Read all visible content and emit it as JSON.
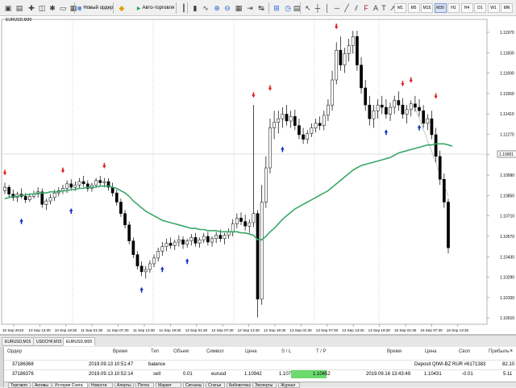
{
  "toolbar": {
    "new_order_label": "Новый ордер",
    "autotrading_label": "Авто-торговля",
    "timeframes": [
      "M1",
      "M5",
      "M15",
      "M30",
      "H1",
      "H4",
      "D1",
      "W1",
      "MN"
    ],
    "icons": [
      "new-chart-icon",
      "profiles-icon",
      "market-watch-icon",
      "data-window-icon",
      "navigator-icon",
      "terminal-icon",
      "tester-icon",
      "new-order-icon",
      "metaeditor-icon",
      "autotrading-icon",
      "bar-chart-icon",
      "candlestick-icon",
      "line-chart-icon",
      "zoom-in-icon",
      "zoom-out-icon",
      "tile-windows-icon",
      "chart-shift-icon",
      "autoscroll-icon",
      "indicators-icon",
      "periods-icon",
      "templates-icon",
      "cursor-icon",
      "crosshair-icon",
      "vertical-line-icon",
      "horizontal-line-icon",
      "trendline-icon",
      "equidistant-channel-icon",
      "fibonacci-icon",
      "text-icon",
      "text-label-icon",
      "arrows-icon"
    ]
  },
  "chart": {
    "title": "EURUSD,M30",
    "current_price_label": "1.10001",
    "price_labels": [
      "1.11970",
      "1.11830",
      "1.11690",
      "1.11550",
      "1.11410",
      "1.11270",
      "1.11130",
      "1.10990",
      "1.10850",
      "1.10710",
      "1.10570",
      "1.10430",
      "1.10290",
      "1.10150",
      "1.10010",
      "1.09870",
      "1.09730",
      "1.09590",
      "1.09450"
    ],
    "time_labels": [
      "10 Sep 2019",
      "10 Sep 13:30",
      "10 Sep 19:30",
      "11 Sep 01:30",
      "11 Sep 07:30",
      "11 Sep 13:30",
      "11 Sep 19:30",
      "12 Sep 01:30",
      "12 Sep 07:30",
      "12 Sep 13:30",
      "12 Sep 19:30",
      "13 Sep 01:30",
      "13 Sep 07:30",
      "13 Sep 13:30",
      "13 Sep 19:30",
      "16 Sep 01:30",
      "16 Sep 07:30",
      "16 Sep 13:30"
    ],
    "colors": {
      "background": "#ffffff",
      "bull_body": "#ffffff",
      "bear_body": "#000000",
      "moving_average": "#3aa86a",
      "sell_arrow": "#e02020",
      "buy_arrow": "#1030c0",
      "grid": "#c0c0c0"
    }
  },
  "chart_tabs": [
    "EURUSD,M15",
    "USDCHF,M15",
    "EURUSD,M30"
  ],
  "chart_tabs_active": 2,
  "terminal": {
    "headers": {
      "order": "Ордер",
      "time": "Время",
      "type": "Тип",
      "volume": "Объем",
      "symbol": "Символ",
      "price": "Цена",
      "sl": "S / L",
      "tp": "T / P",
      "time2": "Время",
      "price2": "Цена",
      "swap": "Своп",
      "profit": "Прибыль"
    },
    "rows": [
      {
        "order": "37186368",
        "time": "2019.09.13 10:51:47",
        "type": "balance",
        "comment": "Deposit QIWI-BZ RUR #6171383",
        "profit": "82.10"
      },
      {
        "order": "37186376",
        "time": "2019.09.13 10:52:14",
        "type": "sell",
        "volume": "0.01",
        "symbol": "eurusd",
        "price": "1.10942",
        "sl": "1.10710",
        "tp": "1.10452",
        "time2": "2019.09.16 13:43:49",
        "price2": "1.10431",
        "swap": "-0.01",
        "profit": "5.11"
      }
    ],
    "bottom_tabs": [
      "Торговля",
      "Активы",
      "История Счета",
      "Новости",
      "Алерты",
      "Почта",
      "Маркет",
      "Сигналы",
      "Статьи",
      "Библиотека",
      "Эксперты",
      "Журнал"
    ],
    "bottom_tabs_active": 2,
    "side_label": "Терминал"
  },
  "chart_data": {
    "type": "candlestick",
    "symbol": "EURUSD",
    "timeframe": "M30",
    "price_range": [
      1.0938,
      1.1205
    ],
    "x_range": [
      "10 Sep 2019",
      "16 Sep 13:30"
    ],
    "grid": true,
    "series": [
      {
        "values": [
          [
            1.1055,
            1.1062,
            1.1052,
            1.1058
          ],
          [
            1.1058,
            1.106,
            1.1049,
            1.1052
          ],
          [
            1.1052,
            1.1056,
            1.1046,
            1.1049
          ],
          [
            1.1049,
            1.1054,
            1.1045,
            1.1052
          ],
          [
            1.1052,
            1.1057,
            1.1048,
            1.105
          ],
          [
            1.105,
            1.1053,
            1.1044,
            1.1047
          ],
          [
            1.1047,
            1.1052,
            1.1045,
            1.105
          ],
          [
            1.105,
            1.1055,
            1.1048,
            1.1052
          ],
          [
            1.1052,
            1.1058,
            1.1049,
            1.1054
          ],
          [
            1.1054,
            1.1057,
            1.104,
            1.1043
          ],
          [
            1.1043,
            1.1048,
            1.1038,
            1.1046
          ],
          [
            1.1046,
            1.1052,
            1.1043,
            1.1049
          ],
          [
            1.1049,
            1.1056,
            1.1046,
            1.1053
          ],
          [
            1.1053,
            1.1058,
            1.105,
            1.1055
          ],
          [
            1.1055,
            1.106,
            1.1052,
            1.1057
          ],
          [
            1.1057,
            1.1064,
            1.1053,
            1.1061
          ],
          [
            1.1061,
            1.1065,
            1.1055,
            1.1058
          ],
          [
            1.1058,
            1.1063,
            1.1055,
            1.106
          ],
          [
            1.106,
            1.1066,
            1.1057,
            1.1063
          ],
          [
            1.1063,
            1.1068,
            1.1058,
            1.1061
          ],
          [
            1.1061,
            1.1064,
            1.1054,
            1.1057
          ],
          [
            1.1057,
            1.1062,
            1.1054,
            1.106
          ],
          [
            1.106,
            1.1066,
            1.1058,
            1.1064
          ],
          [
            1.1064,
            1.1068,
            1.1059,
            1.1062
          ],
          [
            1.1062,
            1.1066,
            1.1058,
            1.1063
          ],
          [
            1.1063,
            1.1066,
            1.1055,
            1.1058
          ],
          [
            1.1058,
            1.1062,
            1.105,
            1.1053
          ],
          [
            1.1053,
            1.1056,
            1.1042,
            1.1045
          ],
          [
            1.1045,
            1.1048,
            1.1032,
            1.1035
          ],
          [
            1.1035,
            1.1038,
            1.1022,
            1.1025
          ],
          [
            1.1025,
            1.1028,
            1.1008,
            1.1011
          ],
          [
            1.1011,
            1.1014,
            1.0996,
            1.0999
          ],
          [
            1.0999,
            1.1002,
            1.0986,
            1.0989
          ],
          [
            1.0989,
            1.0993,
            1.098,
            1.0984
          ],
          [
            1.0984,
            1.0989,
            1.0978,
            1.0986
          ],
          [
            1.0986,
            1.0994,
            1.0983,
            1.0991
          ],
          [
            1.0991,
            1.0999,
            1.0988,
            1.0996
          ],
          [
            1.0996,
            1.1005,
            1.0993,
            1.1002
          ],
          [
            1.1002,
            1.101,
            1.0998,
            1.1006
          ],
          [
            1.1006,
            1.1013,
            1.1002,
            1.1009
          ],
          [
            1.1009,
            1.1014,
            1.1004,
            1.1007
          ],
          [
            1.1007,
            1.1012,
            1.1003,
            1.101
          ],
          [
            1.101,
            1.1016,
            1.1006,
            1.1012
          ],
          [
            1.1012,
            1.1015,
            1.1004,
            1.1008
          ],
          [
            1.1008,
            1.1013,
            1.1005,
            1.1011
          ],
          [
            1.1011,
            1.1017,
            1.1007,
            1.1014
          ],
          [
            1.1014,
            1.1018,
            1.1006,
            1.1009
          ],
          [
            1.1009,
            1.1014,
            1.1005,
            1.1012
          ],
          [
            1.1012,
            1.1018,
            1.1009,
            1.1015
          ],
          [
            1.1015,
            1.1019,
            1.1007,
            1.101
          ],
          [
            1.101,
            1.1015,
            1.1006,
            1.1013
          ],
          [
            1.1013,
            1.1019,
            1.1009,
            1.1016
          ],
          [
            1.1016,
            1.1021,
            1.101,
            1.1013
          ],
          [
            1.1013,
            1.1018,
            1.1008,
            1.1016
          ],
          [
            1.1016,
            1.1022,
            1.1013,
            1.1019
          ],
          [
            1.1019,
            1.103,
            1.1015,
            1.1026
          ],
          [
            1.1026,
            1.1035,
            1.1022,
            1.1031
          ],
          [
            1.1031,
            1.1036,
            1.1025,
            1.1028
          ],
          [
            1.1028,
            1.1034,
            1.102,
            1.1024
          ],
          [
            1.1024,
            1.103,
            1.1018,
            1.1027
          ],
          [
            1.1027,
            1.113,
            1.1023,
            1.1035
          ],
          [
            1.1035,
            1.1038,
            1.0944,
            1.096
          ],
          [
            1.096,
            1.106,
            1.0955,
            1.1045
          ],
          [
            1.1045,
            1.1085,
            1.104,
            1.1075
          ],
          [
            1.1075,
            1.1118,
            1.107,
            1.111
          ],
          [
            1.111,
            1.1125,
            1.11,
            1.1115
          ],
          [
            1.1115,
            1.1125,
            1.1105,
            1.1118
          ],
          [
            1.1118,
            1.1128,
            1.111,
            1.1122
          ],
          [
            1.1122,
            1.113,
            1.1112,
            1.1116
          ],
          [
            1.1116,
            1.1125,
            1.111,
            1.112
          ],
          [
            1.112,
            1.1126,
            1.1108,
            1.1112
          ],
          [
            1.1112,
            1.1118,
            1.11,
            1.1104
          ],
          [
            1.1104,
            1.111,
            1.1096,
            1.11
          ],
          [
            1.11,
            1.1108,
            1.1096,
            1.1105
          ],
          [
            1.1105,
            1.1114,
            1.1102,
            1.111
          ],
          [
            1.111,
            1.1118,
            1.1106,
            1.1114
          ],
          [
            1.1114,
            1.112,
            1.1108,
            1.1112
          ],
          [
            1.1112,
            1.1125,
            1.1108,
            1.1121
          ],
          [
            1.1121,
            1.1135,
            1.1116,
            1.113
          ],
          [
            1.113,
            1.116,
            1.1125,
            1.1152
          ],
          [
            1.1152,
            1.1185,
            1.1148,
            1.1178
          ],
          [
            1.1178,
            1.119,
            1.116,
            1.1165
          ],
          [
            1.1165,
            1.118,
            1.1158,
            1.1175
          ],
          [
            1.1175,
            1.1188,
            1.1168,
            1.1182
          ],
          [
            1.1182,
            1.1195,
            1.1175,
            1.119
          ],
          [
            1.119,
            1.1195,
            1.116,
            1.1165
          ],
          [
            1.1165,
            1.1172,
            1.114,
            1.1145
          ],
          [
            1.1145,
            1.1152,
            1.1125,
            1.113
          ],
          [
            1.113,
            1.1138,
            1.1112,
            1.1118
          ],
          [
            1.1118,
            1.113,
            1.111,
            1.1125
          ],
          [
            1.1125,
            1.1135,
            1.1118,
            1.113
          ],
          [
            1.113,
            1.1138,
            1.1122,
            1.1128
          ],
          [
            1.1128,
            1.1135,
            1.1118,
            1.1122
          ],
          [
            1.1122,
            1.1132,
            1.1116,
            1.1128
          ],
          [
            1.1128,
            1.1138,
            1.1122,
            1.1134
          ],
          [
            1.1134,
            1.1142,
            1.1125,
            1.113
          ],
          [
            1.113,
            1.1136,
            1.1118,
            1.1122
          ],
          [
            1.1122,
            1.113,
            1.1114,
            1.1126
          ],
          [
            1.1126,
            1.1134,
            1.112,
            1.1131
          ],
          [
            1.1131,
            1.1138,
            1.1124,
            1.1128
          ],
          [
            1.1128,
            1.1135,
            1.112,
            1.1125
          ],
          [
            1.1125,
            1.113,
            1.111,
            1.1114
          ],
          [
            1.1114,
            1.1122,
            1.1108,
            1.1118
          ],
          [
            1.1118,
            1.1125,
            1.11,
            1.1104
          ],
          [
            1.1104,
            1.111,
            1.108,
            1.1085
          ],
          [
            1.1085,
            1.109,
            1.106,
            1.1065
          ],
          [
            1.1065,
            1.107,
            1.104,
            1.1045
          ],
          [
            1.1045,
            1.1048,
            1.1,
            1.1005
          ]
        ]
      },
      {
        "name": "Moving Average",
        "values": [
          1.1048,
          1.1049,
          1.105,
          1.105,
          1.1051,
          1.1051,
          1.1052,
          1.1052,
          1.1053,
          1.1053,
          1.1053,
          1.1054,
          1.1054,
          1.1054,
          1.1055,
          1.1055,
          1.1056,
          1.1056,
          1.1057,
          1.1057,
          1.1058,
          1.1058,
          1.1058,
          1.1059,
          1.1059,
          1.1059,
          1.1058,
          1.1057,
          1.1055,
          1.1053,
          1.105,
          1.1046,
          1.1043,
          1.104,
          1.1037,
          1.1035,
          1.1033,
          1.1031,
          1.1029,
          1.1028,
          1.1027,
          1.1026,
          1.1025,
          1.1024,
          1.1023,
          1.1022,
          1.1022,
          1.1021,
          1.1021,
          1.102,
          1.102,
          1.102,
          1.1019,
          1.1019,
          1.1019,
          1.1019,
          1.1019,
          1.1018,
          1.1018,
          1.1017,
          1.1016,
          1.1012,
          1.1012,
          1.1015,
          1.1019,
          1.1022,
          1.1026,
          1.103,
          1.1033,
          1.1036,
          1.1039,
          1.1041,
          1.1043,
          1.1045,
          1.1047,
          1.1049,
          1.1051,
          1.1053,
          1.1055,
          1.1058,
          1.1061,
          1.1064,
          1.1067,
          1.107,
          1.1073,
          1.1075,
          1.1077,
          1.1078,
          1.1079,
          1.108,
          1.1081,
          1.1082,
          1.1083,
          1.1084,
          1.1086,
          1.1088,
          1.1089,
          1.109,
          1.1091,
          1.1092,
          1.1093,
          1.1094,
          1.1095,
          1.1095,
          1.1096,
          1.1096,
          1.1096,
          1.1095,
          1.1094
        ]
      }
    ],
    "sell_signals": [
      [
        0,
        1.1069
      ],
      [
        14,
        1.1071
      ],
      [
        24,
        1.1075
      ],
      [
        60,
        1.1137
      ],
      [
        64,
        1.1143
      ],
      [
        80,
        1.1197
      ],
      [
        84,
        1.1209
      ],
      [
        96,
        1.1147
      ],
      [
        98,
        1.115
      ],
      [
        104,
        1.1136
      ]
    ],
    "buy_signals": [
      [
        4,
        1.103
      ],
      [
        16,
        1.1039
      ],
      [
        33,
        1.097
      ],
      [
        38,
        1.0988
      ],
      [
        44,
        1.0995
      ],
      [
        61,
        1.0928
      ],
      [
        67,
        1.1093
      ],
      [
        92,
        1.1108
      ],
      [
        100,
        1.1112
      ]
    ]
  }
}
